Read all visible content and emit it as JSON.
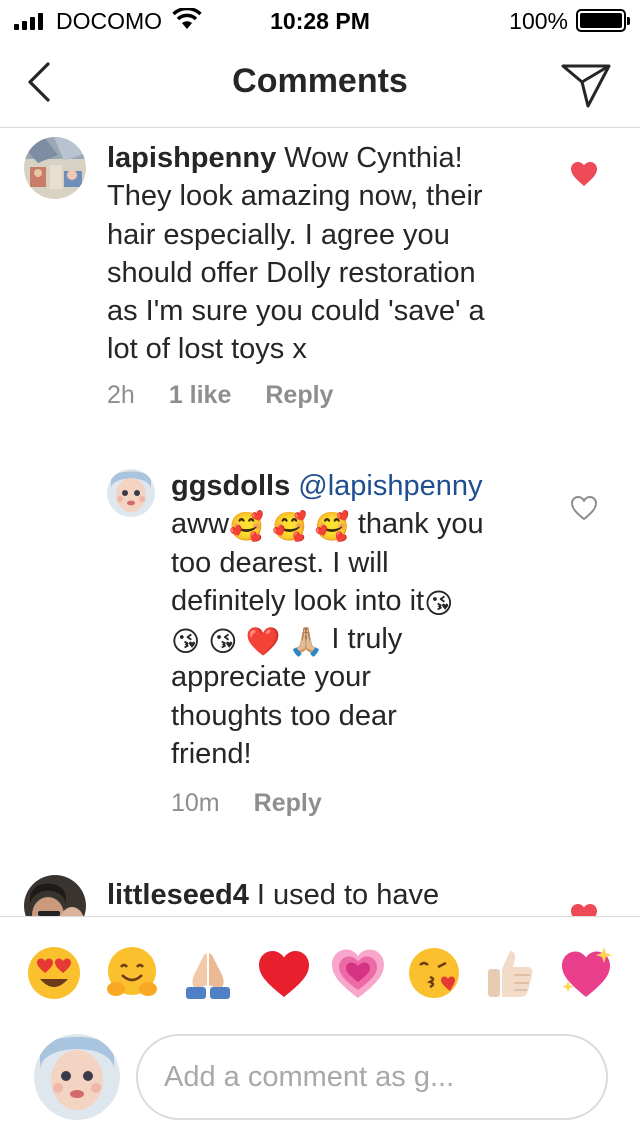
{
  "status_bar": {
    "carrier": "DOCOMO",
    "time": "10:28 PM",
    "battery_percent": "100%",
    "battery_level": 1.0
  },
  "header": {
    "title": "Comments",
    "back_icon": "chevron-left-icon",
    "share_icon": "paper-plane-icon"
  },
  "comments": [
    {
      "username": "lapishpenny",
      "text_lines": [
        "Wow Cynthia!",
        "They look amazing now, their",
        "hair especially. I agree you",
        "should offer Dolly restoration",
        "as I'm sure you could 'save' a",
        "lot of lost toys x"
      ],
      "time": "2h",
      "likes": "1 like",
      "reply_label": "Reply",
      "liked": true
    },
    {
      "username": "ggsdolls",
      "mention": "@lapishpenny",
      "text_lines": [
        "aww",
        "thank you",
        "too dearest. I will",
        "definitely look into it",
        "I truly",
        "appreciate your",
        "thoughts too dear",
        "friend!"
      ],
      "emojis": {
        "hearts_face": "🥰",
        "kiss_face": "😘",
        "red_heart": "❤️",
        "pray": "🙏🏼"
      },
      "time": "10m",
      "reply_label": "Reply",
      "liked": false
    },
    {
      "username": "littleseed4",
      "text_start": "I used to have",
      "liked": true
    }
  ],
  "emoji_bar": [
    "😍",
    "🤗",
    "🙏",
    "❤️",
    "💗",
    "😘",
    "👍🏻",
    "💖"
  ],
  "input": {
    "placeholder": "Add a comment as g..."
  },
  "colors": {
    "heart_red": "#ed4956",
    "mention_blue": "#1f4f91",
    "meta_gray": "#8e8e8e",
    "divider": "#dbdbdb"
  }
}
